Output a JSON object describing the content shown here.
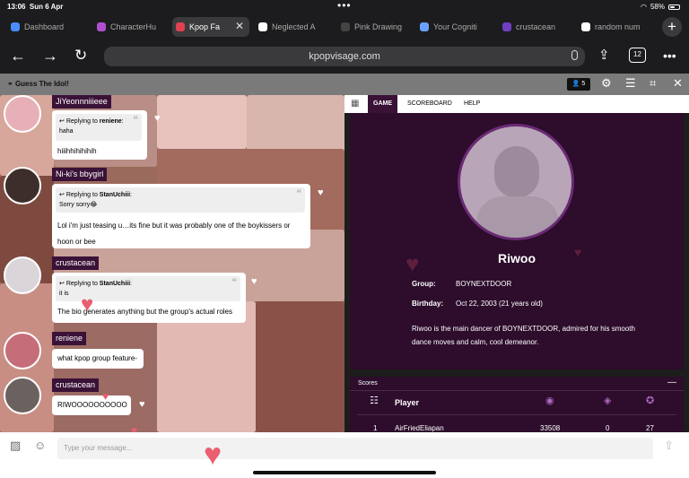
{
  "status": {
    "time": "13:06",
    "date": "Sun 6 Apr",
    "battery": "58%",
    "battery_level": 0.58
  },
  "tabs": [
    {
      "label": "Dashboard",
      "color": "#4a8cff",
      "active": false
    },
    {
      "label": "CharacterHu",
      "color": "#b050d0",
      "active": false
    },
    {
      "label": "Kpop Fa",
      "color": "#e04050",
      "active": true
    },
    {
      "label": "Neglected A",
      "color": "#ffffff",
      "active": false
    },
    {
      "label": "Pink Drawing",
      "color": "#444444",
      "active": false
    },
    {
      "label": "Your Cogniti",
      "color": "#6aa0ff",
      "active": false
    },
    {
      "label": "crustacean",
      "color": "#7040c0",
      "active": false
    },
    {
      "label": "random num",
      "color": "#ffffff",
      "active": false
    }
  ],
  "toolbar": {
    "url": "kpopvisage.com",
    "tab_count": "12"
  },
  "gamebar": {
    "title": "Guess The Idol!",
    "users": "5"
  },
  "chat": {
    "messages": [
      {
        "username": "JiYeonnniiieee",
        "reply_to": "reniene",
        "quote": "haha",
        "text": "hiiihhihihihih"
      },
      {
        "username": "Ni-ki's bbygirl",
        "reply_to": "StanUchiii",
        "quote": "Sorry sorry😂",
        "text": "Lol i'm just teasing u…its fine but it was probably one of the boykissers or hoon or bee"
      },
      {
        "username": "crustacean",
        "reply_to": "StanUchiii",
        "quote": "it is",
        "text": "The bio generates anything but the group's actual roles"
      },
      {
        "username": "reniene",
        "text": "what kpop group feature-"
      },
      {
        "username": "crustacean",
        "text": "RIWOOOOOOOOOO"
      }
    ],
    "replying_to_label": "Replying to",
    "input_placeholder": "Type your message..."
  },
  "right_tabs": [
    "GAME",
    "SCOREBOARD",
    "HELP"
  ],
  "profile": {
    "name": "Riwoo",
    "group_label": "Group:",
    "group": "BOYNEXTDOOR",
    "birthday_label": "Birthday:",
    "birthday": "Oct 22, 2003 (21 years old)",
    "description": "Riwoo is the main dancer of BOYNEXTDOOR, admired for his smooth dance moves and calm, cool demeanor."
  },
  "scores": {
    "title": "Scores",
    "player_header": "Player",
    "rows": [
      {
        "rank": "1",
        "player": "AirFriedEliapan",
        "points": "33508",
        "streak": "0",
        "wins": "27"
      }
    ]
  },
  "colors": {
    "accent": "#3a1238",
    "panel": "#2d0c2c",
    "heart": "#e96070"
  }
}
